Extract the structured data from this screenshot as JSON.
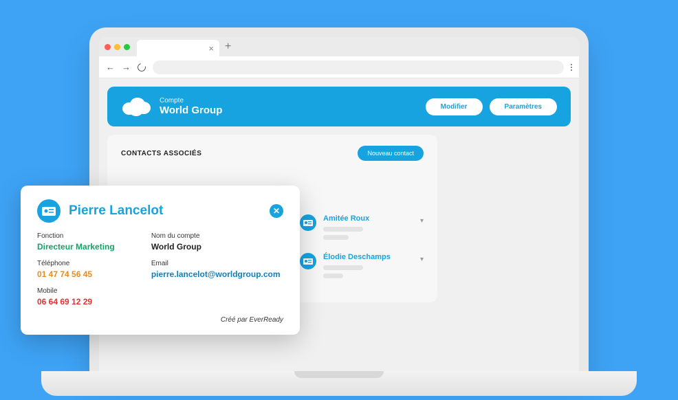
{
  "header": {
    "subtitle": "Compte",
    "title": "World Group",
    "modify_btn": "Modifier",
    "params_btn": "Paramètres"
  },
  "contacts": {
    "section_title": "CONTACTS ASSOCIÉS",
    "new_btn": "Nouveau contact",
    "items": [
      {
        "name": "Amitée Roux"
      },
      {
        "name": "Élodie Deschamps"
      }
    ]
  },
  "detail": {
    "name": "Pierre Lancelot",
    "fields": {
      "fonction_label": "Fonction",
      "fonction_value": "Directeur Marketing",
      "compte_label": "Nom du compte",
      "compte_value": "World Group",
      "tel_label": "Téléphone",
      "tel_value": "01 47 74 56 45",
      "email_label": "Email",
      "email_value": "pierre.lancelot@worldgroup.com",
      "mobile_label": "Mobile",
      "mobile_value": "06 64 69 12 29"
    },
    "footer": "Créé par EverReady"
  }
}
